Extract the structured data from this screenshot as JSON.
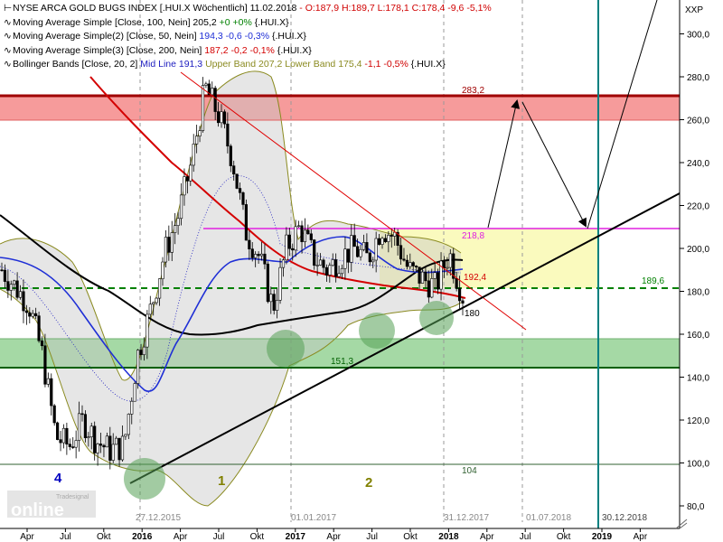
{
  "legend": {
    "line1_prefix": "NYSE ARCA GOLD BUGS INDEX [.HUI.X  Wöchentlich] 11.02.2018",
    "line1_values": "- O:187,9 H:189,7 L:178,1 C:178,4 -9,6 -5,1%",
    "line2_prefix": "Moving Average Simple [Close, 100, Nein] 205,2",
    "line2_values": "+0 +0%",
    "line2_suffix": "{.HUI.X}",
    "line3_prefix": "Moving Average Simple(2) [Close, 50, Nein]",
    "line3_values": "194,3 -0,6 -0,3%",
    "line3_suffix": "{.HUI.X}",
    "line4_prefix": "Moving Average Simple(3) [Close, 200, Nein]",
    "line4_values": "187,2 -0,2 -0,1%",
    "line4_suffix": "{.HUI.X}",
    "line5_prefix": "Bollinger Bands [Close, 20, 2]",
    "line5_mid": "Mid Line 191,3",
    "line5_upper": "Upper Band 207,2",
    "line5_lower": "Lower Band 175,4",
    "line5_values": "-1,1 -0,5%",
    "line5_suffix": "{.HUI.X}"
  },
  "branding": {
    "logo_text": "online",
    "logo_small": "Tradesignal"
  },
  "colors": {
    "candles": "#000000",
    "ma100": "#000000",
    "ma50": "#1f2fd6",
    "ma200": "#d40000",
    "bollinger_band": "#8a8a20",
    "bollinger_mid": "#2020c0",
    "resistance_zone": "#f58a8a",
    "support_zone": "#8fcf8f",
    "target_zone": "#fafabe",
    "trendline": "#000000",
    "magenta_line": "#e020e0",
    "green_dashed": "#008000",
    "vertical_line": "#008080",
    "wave_labels_1_2": "#808000",
    "wave_label_4": "#0000c0"
  },
  "chart_data": {
    "type": "candlestick",
    "title": "NYSE ARCA GOLD BUGS INDEX [.HUI.X  Wöchentlich]",
    "y_unit_label": "XXP",
    "ylim": [
      80,
      320
    ],
    "yticks": [
      "80,0",
      "100,0",
      "120,0",
      "140,0",
      "160,0",
      "180,0",
      "200,0",
      "220,0",
      "240,0",
      "260,0",
      "280,0",
      "300,0"
    ],
    "x_ticks": [
      "Apr",
      "Jul",
      "Okt",
      "2016",
      "Apr",
      "Jul",
      "Okt",
      "2017",
      "Apr",
      "Jul",
      "Okt",
      "2018",
      "Apr",
      "Jul",
      "Okt",
      "2019",
      "Apr"
    ],
    "bold_x_ticks": [
      "2016",
      "2017",
      "2018",
      "2019"
    ],
    "x_date_markers": [
      "27.12.2015",
      "01.01.2017",
      "31.12.2017",
      "01.07.2018",
      "30.12.2018"
    ],
    "series": [
      {
        "name": "Close",
        "x": [
          "2015-04",
          "2015-05",
          "2015-06",
          "2015-07",
          "2015-08",
          "2015-09",
          "2015-10",
          "2015-11",
          "2015-12",
          "2016-01",
          "2016-02",
          "2016-03",
          "2016-04",
          "2016-05",
          "2016-06",
          "2016-07",
          "2016-08",
          "2016-09",
          "2016-10",
          "2016-11",
          "2016-12",
          "2017-01",
          "2017-02",
          "2017-03",
          "2017-04",
          "2017-05",
          "2017-06",
          "2017-07",
          "2017-08",
          "2017-09",
          "2017-10",
          "2017-11",
          "2017-12",
          "2018-01",
          "2018-02"
        ],
        "values": [
          190,
          182,
          174,
          150,
          112,
          108,
          120,
          110,
          106,
          108,
          150,
          172,
          198,
          215,
          240,
          275,
          262,
          242,
          208,
          196,
          172,
          200,
          210,
          196,
          190,
          196,
          200,
          195,
          210,
          205,
          190,
          186,
          182,
          198,
          178
        ]
      }
    ],
    "horizontal_levels": [
      {
        "label": "283,2",
        "value": 283.2
      },
      {
        "label": "218,8",
        "value": 218.8
      },
      {
        "label": "192,4",
        "value": 192.4
      },
      {
        "label": "189,6",
        "value": 189.6
      },
      {
        "label": "180",
        "value": 180
      },
      {
        "label": "151,3",
        "value": 151.3
      },
      {
        "label": "104",
        "value": 104
      }
    ],
    "zones": [
      {
        "name": "resistance",
        "from": 271,
        "to": 283.2
      },
      {
        "name": "target",
        "from": 189.6,
        "to": 218.8
      },
      {
        "name": "support",
        "from": 151.3,
        "to": 165
      }
    ],
    "wave_labels": [
      {
        "label": "4",
        "x": "2015-08",
        "value": 100
      },
      {
        "label": "1",
        "x": "2016-06",
        "value": 98
      },
      {
        "label": "2",
        "x": "2017-07",
        "value": 97
      }
    ]
  }
}
